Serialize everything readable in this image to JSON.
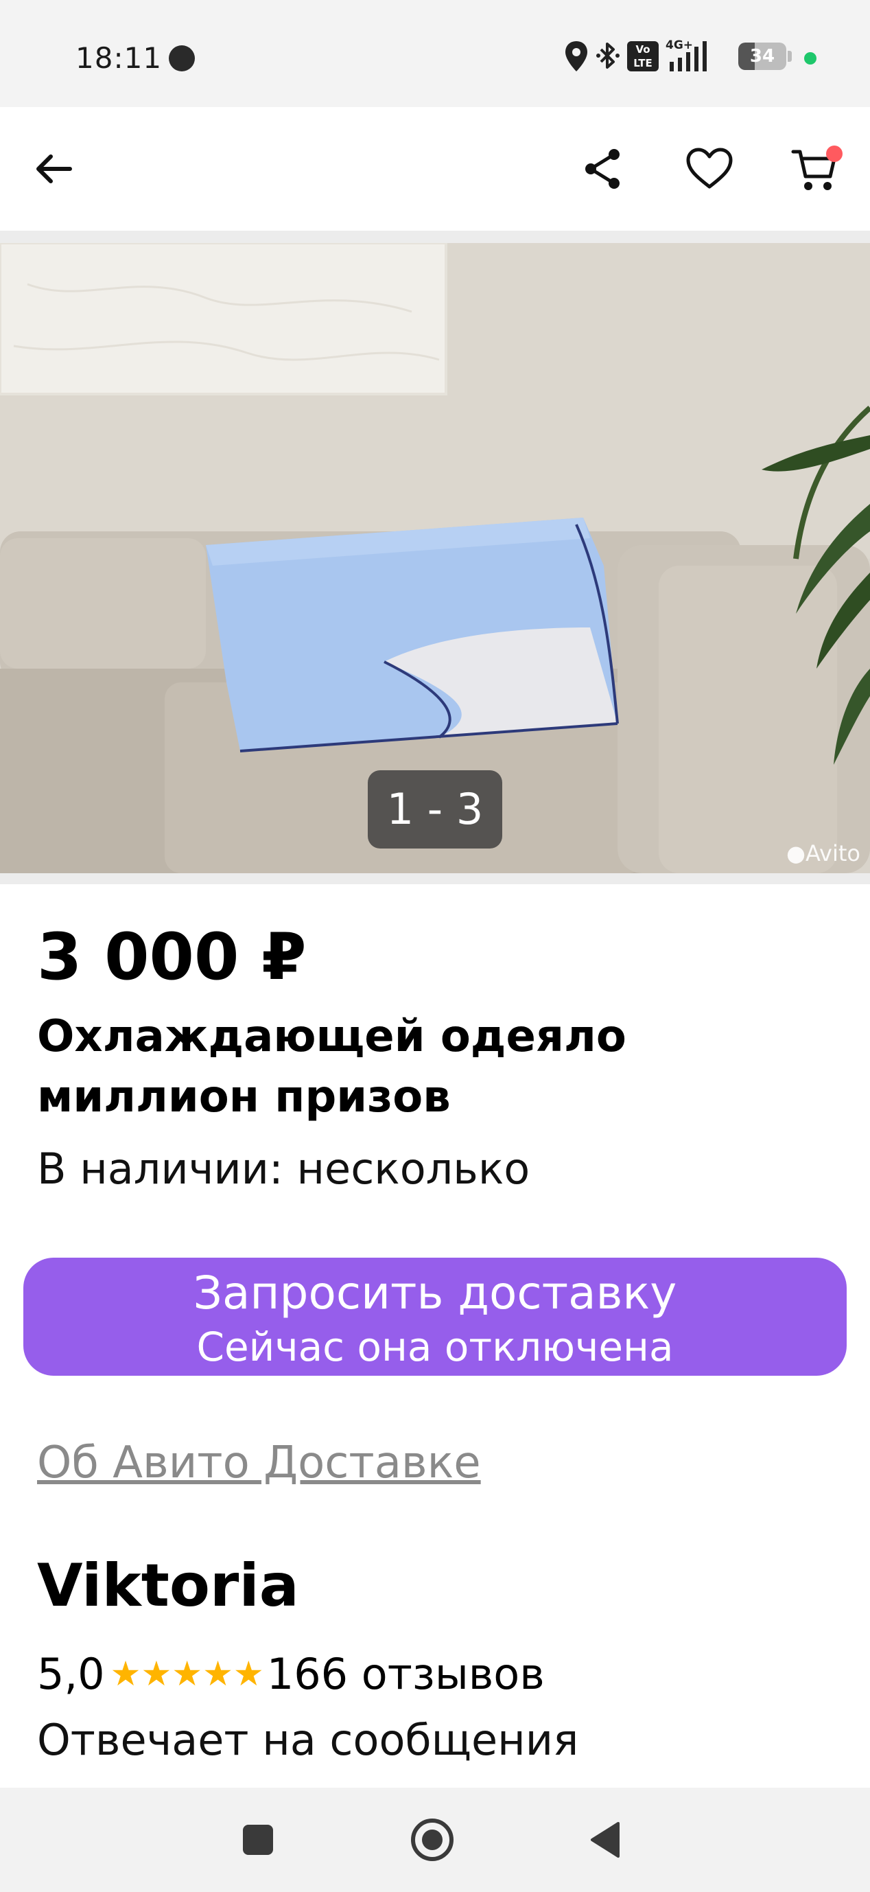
{
  "status_bar": {
    "time": "18:11",
    "network_label": "4G+",
    "volte_label": "Vo LTE",
    "battery_level": "34"
  },
  "header": {
    "back_icon": "back-arrow-icon",
    "share_icon": "share-icon",
    "favorite_icon": "heart-icon",
    "cart_icon": "cart-icon"
  },
  "gallery": {
    "counter": "1 - 3",
    "watermark": "Avito"
  },
  "listing": {
    "price": "3 000 ₽",
    "title": "Охлаждающей одеяло миллион призов",
    "availability": "В наличии: несколько"
  },
  "delivery": {
    "button_label": "Запросить доставку",
    "button_sublabel": "Сейчас она отключена",
    "about_link": "Об Авито Доставке"
  },
  "seller": {
    "name": "Viktoria",
    "rating": "5,0",
    "stars": 5,
    "reviews": "166 отзывов",
    "reply_note": "Отвечает на сообщения"
  },
  "colors": {
    "accent": "#965eeb",
    "star": "#ffb400",
    "badge": "#ff5a5f"
  },
  "nav_bar": {
    "recents_icon": "square-icon",
    "home_icon": "circle-home-icon",
    "back_icon": "triangle-back-icon"
  }
}
